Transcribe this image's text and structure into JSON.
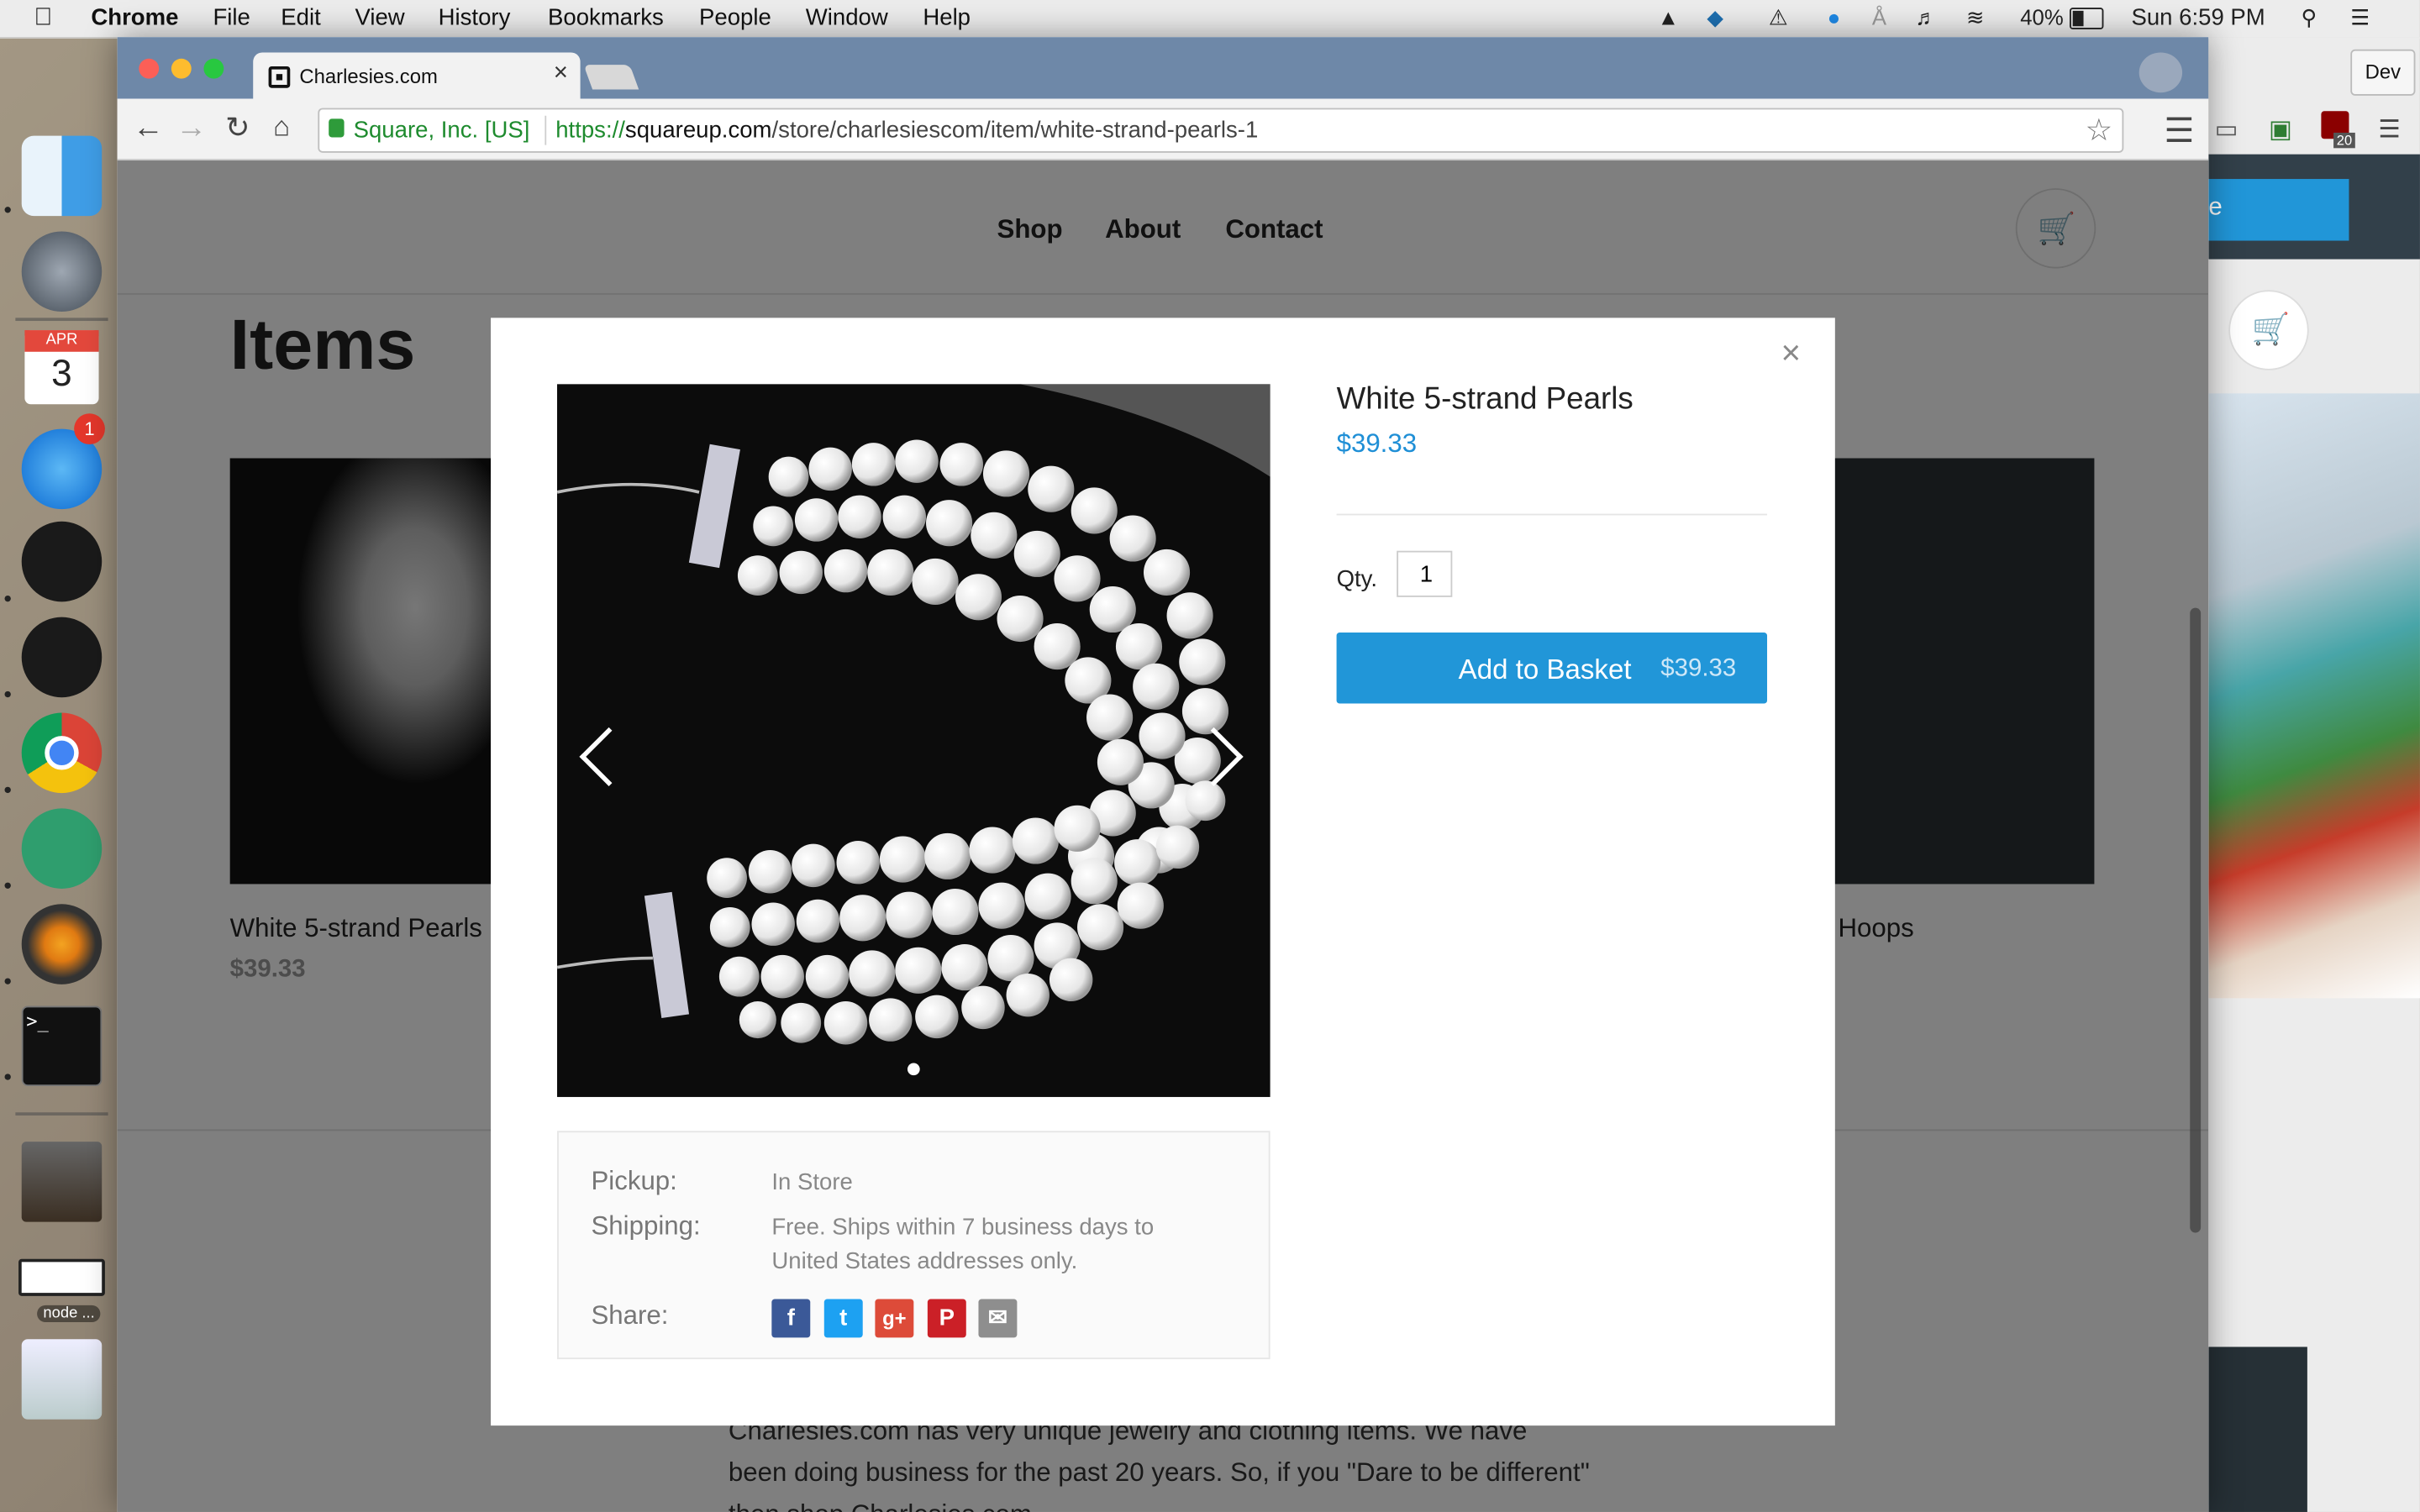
{
  "menubar": {
    "app": "Chrome",
    "menus": [
      "File",
      "Edit",
      "View",
      "History",
      "Bookmarks",
      "People",
      "Window",
      "Help"
    ],
    "battery": "40%",
    "clock": "Sun 6:59 PM"
  },
  "dock": {
    "calendar_month": "APR",
    "calendar_day": "3",
    "appstore_badge": "1",
    "node_label": "node ..."
  },
  "right_window": {
    "dev_label": "Dev",
    "button_fragment": "e"
  },
  "browser": {
    "tab_title": "Charlesies.com",
    "ev_label": "Square, Inc. [US]",
    "url_scheme": "https://",
    "url_host": "squareup.com",
    "url_path": "/store/charlesiescom/item/white-strand-pearls-1",
    "ext_badge": "20"
  },
  "site": {
    "nav": [
      "Shop",
      "About",
      "Contact"
    ],
    "heading": "Items",
    "cards": [
      {
        "name": "White 5-strand Pearls",
        "price": "$39.33"
      },
      {
        "name": "Hoops",
        "price": ""
      }
    ],
    "about_text": "Charlesies.com has very unique jewelry and clothing items.  We have been doing business for the past 20 years.  So, if you \"Dare to be different\" then shop Charlesies.com."
  },
  "modal": {
    "product_name": "White 5-strand Pearls",
    "price": "$39.33",
    "qty_label": "Qty.",
    "qty_value": "1",
    "add_label": "Add to Basket",
    "add_price": "$39.33",
    "pickup_label": "Pickup:",
    "pickup_value": "In Store",
    "shipping_label": "Shipping:",
    "shipping_value": "Free. Ships within 7 business days to United States addresses only.",
    "share_label": "Share:",
    "share_icons": [
      "facebook-icon",
      "twitter-icon",
      "google-plus-icon",
      "pinterest-icon",
      "email-icon"
    ]
  },
  "colors": {
    "accent": "#2196d8",
    "price": "#1f8fd6",
    "facebook": "#3b5998",
    "twitter": "#1da1f2",
    "google_plus": "#dd4b39",
    "pinterest": "#cb2027",
    "email": "#8e8e8e"
  }
}
